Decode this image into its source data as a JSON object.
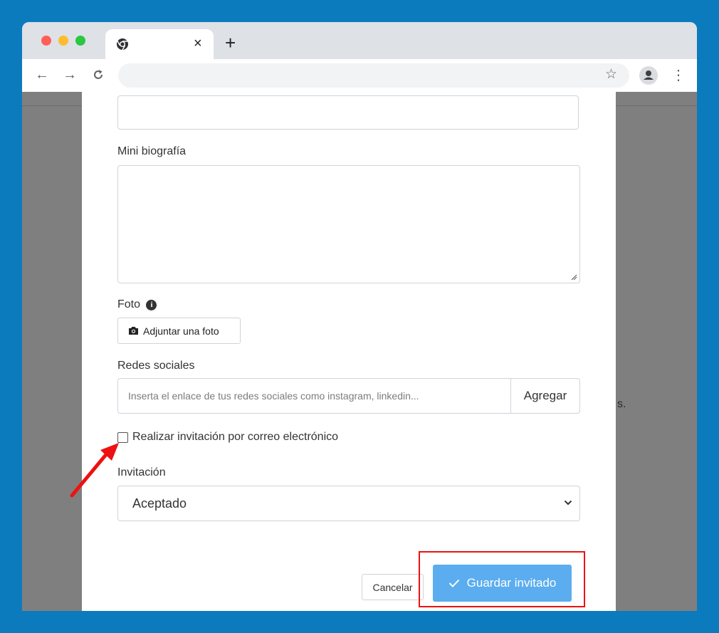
{
  "browser": {
    "tab_close": "×",
    "new_tab": "+"
  },
  "form": {
    "bio_label": "Mini biografía",
    "photo_label": "Foto",
    "photo_button": "Adjuntar una foto",
    "social_label": "Redes sociales",
    "social_placeholder": "Inserta el enlace de tus redes sociales como instagram, linkedin...",
    "social_add": "Agregar",
    "email_invite_label": "Realizar invitación por correo electrónico",
    "invitation_label": "Invitación",
    "invitation_value": "Aceptado",
    "cancel": "Cancelar",
    "save": "Guardar invitado"
  },
  "background_text": "s.",
  "colors": {
    "page_bg": "#0c7bbd",
    "save_button": "#5badf0",
    "highlight": "#ee1111",
    "arrow": "#ee1111"
  }
}
